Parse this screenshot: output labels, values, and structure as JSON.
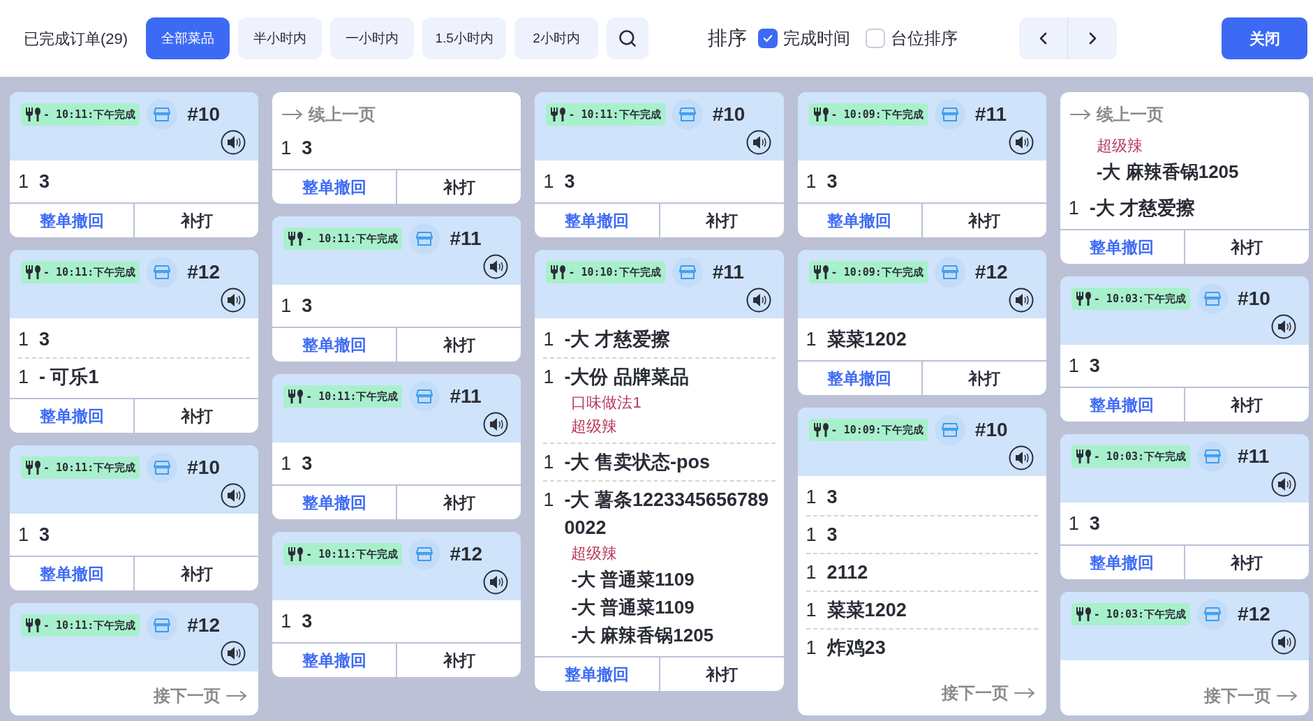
{
  "toolbar": {
    "title": "已完成订单(29)",
    "filters": [
      {
        "label": "全部菜品",
        "selected": true
      },
      {
        "label": "半小时内",
        "selected": false
      },
      {
        "label": "一小时内",
        "selected": false
      },
      {
        "label": "1.5小时内",
        "selected": false
      },
      {
        "label": "2小时内",
        "selected": false
      }
    ],
    "sort": {
      "label": "排序",
      "options": [
        {
          "label": "完成时间",
          "checked": true
        },
        {
          "label": "台位排序",
          "checked": false
        }
      ]
    },
    "close": "关闭"
  },
  "columns": [
    [
      {
        "kind": "order",
        "time": "- 10:11:下午完成",
        "number": "#10",
        "items": [
          {
            "qty": "1",
            "name": "3"
          }
        ],
        "actions": [
          "整单撤回",
          "补打"
        ]
      },
      {
        "kind": "order",
        "time": "- 10:11:下午完成",
        "number": "#12",
        "items": [
          {
            "qty": "1",
            "name": "3"
          },
          {
            "qty": "1",
            "name": "- 可乐1"
          }
        ],
        "actions": [
          "整单撤回",
          "补打"
        ]
      },
      {
        "kind": "order",
        "time": "- 10:11:下午完成",
        "number": "#10",
        "items": [
          {
            "qty": "1",
            "name": "3"
          }
        ],
        "actions": [
          "整单撤回",
          "补打"
        ]
      },
      {
        "kind": "order",
        "time": "- 10:11:下午完成",
        "number": "#12",
        "next_page": "接下一页"
      }
    ],
    [
      {
        "kind": "continuation",
        "continued": "续上一页",
        "items": [
          {
            "qty": "1",
            "name": "3"
          }
        ],
        "actions": [
          "整单撤回",
          "补打"
        ]
      },
      {
        "kind": "order",
        "time": "- 10:11:下午完成",
        "number": "#11",
        "items": [
          {
            "qty": "1",
            "name": "3"
          }
        ],
        "actions": [
          "整单撤回",
          "补打"
        ]
      },
      {
        "kind": "order",
        "time": "- 10:11:下午完成",
        "number": "#11",
        "items": [
          {
            "qty": "1",
            "name": "3"
          }
        ],
        "actions": [
          "整单撤回",
          "补打"
        ]
      },
      {
        "kind": "order",
        "time": "- 10:11:下午完成",
        "number": "#12",
        "items": [
          {
            "qty": "1",
            "name": "3"
          }
        ],
        "actions": [
          "整单撤回",
          "补打"
        ]
      }
    ],
    [
      {
        "kind": "order",
        "time": "- 10:11:下午完成",
        "number": "#10",
        "items": [
          {
            "qty": "1",
            "name": "3"
          }
        ],
        "actions": [
          "整单撤回",
          "补打"
        ]
      },
      {
        "kind": "order",
        "time": "- 10:10:下午完成",
        "number": "#11",
        "items": [
          {
            "qty": "1",
            "name": "-大 才慈爱擦"
          },
          {
            "qty": "1",
            "name": "-大份 品牌菜品",
            "notes": [
              "口味做法1",
              "超级辣"
            ]
          },
          {
            "qty": "1",
            "name": "-大 售卖状态-pos"
          },
          {
            "qty": "1",
            "name": "-大 薯条12233456567890022",
            "notes": [
              "超级辣"
            ],
            "subs": [
              "-大 普通菜1109",
              "-大 普通菜1109",
              "-大 麻辣香锅1205"
            ]
          }
        ],
        "actions": [
          "整单撤回",
          "补打"
        ]
      }
    ],
    [
      {
        "kind": "order",
        "time": "- 10:09:下午完成",
        "number": "#11",
        "items": [
          {
            "qty": "1",
            "name": "3"
          }
        ],
        "actions": [
          "整单撤回",
          "补打"
        ]
      },
      {
        "kind": "order",
        "time": "- 10:09:下午完成",
        "number": "#12",
        "items": [
          {
            "qty": "1",
            "name": "菜菜1202"
          }
        ],
        "actions": [
          "整单撤回",
          "补打"
        ]
      },
      {
        "kind": "order",
        "time": "- 10:09:下午完成",
        "number": "#10",
        "items": [
          {
            "qty": "1",
            "name": "3"
          },
          {
            "qty": "1",
            "name": "3"
          },
          {
            "qty": "1",
            "name": "2112"
          },
          {
            "qty": "1",
            "name": "菜菜1202"
          },
          {
            "qty": "1",
            "name": "炸鸡23"
          }
        ],
        "next_page": "接下一页"
      }
    ],
    [
      {
        "kind": "continuation",
        "continued": "续上一页",
        "items": [
          {
            "notes": [
              "超级辣"
            ],
            "subs": [
              "-大 麻辣香锅1205"
            ]
          },
          {
            "qty": "1",
            "name": "-大 才慈爱擦"
          }
        ],
        "actions": [
          "整单撤回",
          "补打"
        ]
      },
      {
        "kind": "order",
        "time": "- 10:03:下午完成",
        "number": "#10",
        "items": [
          {
            "qty": "1",
            "name": "3"
          }
        ],
        "actions": [
          "整单撤回",
          "补打"
        ]
      },
      {
        "kind": "order",
        "time": "- 10:03:下午完成",
        "number": "#11",
        "items": [
          {
            "qty": "1",
            "name": "3"
          }
        ],
        "actions": [
          "整单撤回",
          "补打"
        ]
      },
      {
        "kind": "order",
        "time": "- 10:03:下午完成",
        "number": "#12",
        "next_page": "接下一页"
      }
    ]
  ]
}
